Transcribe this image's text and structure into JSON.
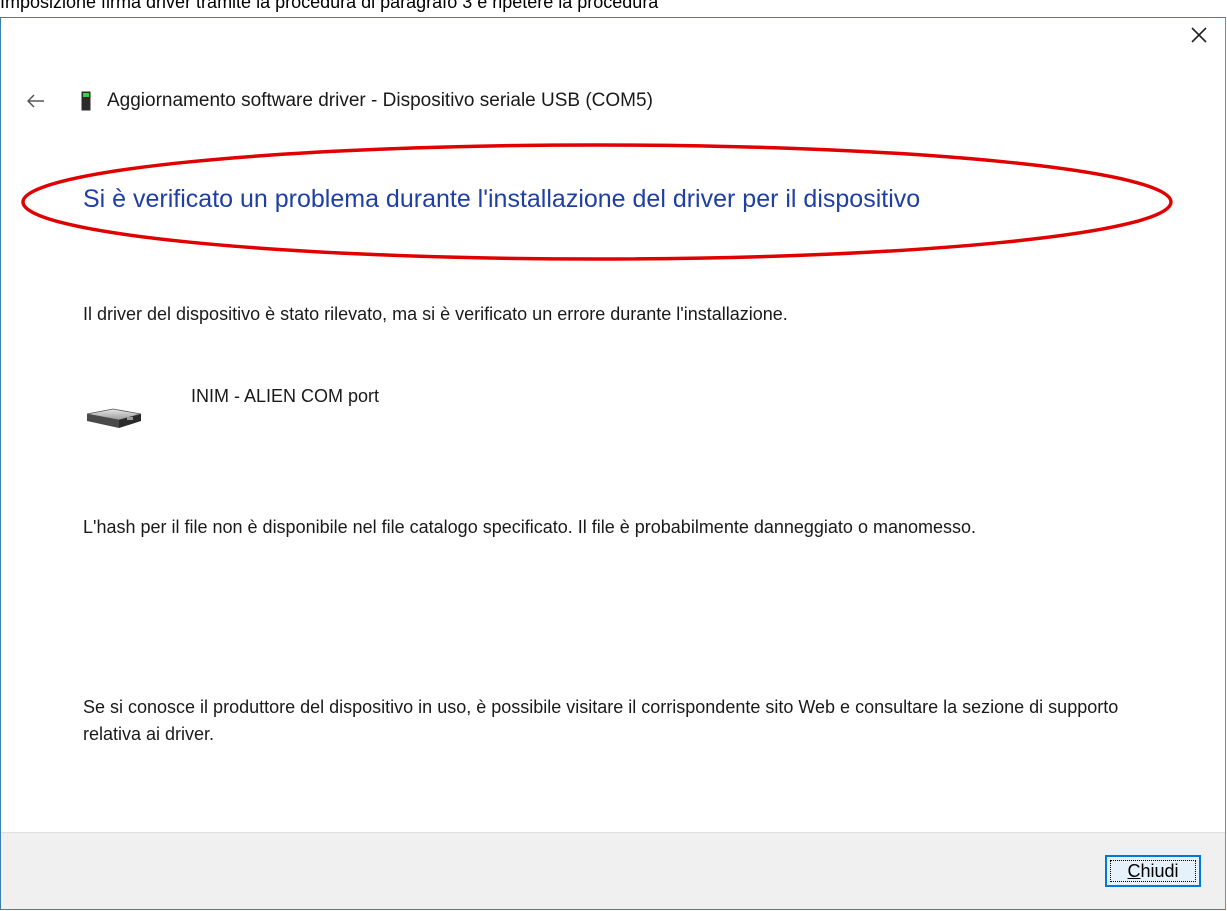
{
  "page_caption": "Imposizione firma driver tramite la procedura di paragrafo 3 e ripetere la procedura",
  "dialog": {
    "title": "Aggiornamento software driver - Dispositivo seriale USB (COM5)",
    "close_icon": "close-icon",
    "back_icon": "back-arrow-icon"
  },
  "content": {
    "headline": "Si è verificato un problema durante l'installazione del driver per il dispositivo",
    "paragraph1": "Il driver del dispositivo è stato rilevato, ma si è verificato un errore durante l'installazione.",
    "device_name": "INIM - ALIEN COM port",
    "device_icon": "serial-port-device-icon",
    "paragraph2": "L'hash per il file non è disponibile nel file catalogo specificato. Il file è probabilmente danneggiato o manomesso.",
    "paragraph3": "Se si conosce il produttore del dispositivo in uso, è possibile visitare il corrispondente sito Web e consultare la sezione di supporto relativa ai driver."
  },
  "footer": {
    "close_button_mnemonic": "C",
    "close_button_rest": "hiudi"
  },
  "colors": {
    "headline": "#1f3fa5",
    "annotation_ellipse": "#e00000",
    "button_focus": "#0078d7",
    "footer_bg": "#f0f0f0"
  }
}
